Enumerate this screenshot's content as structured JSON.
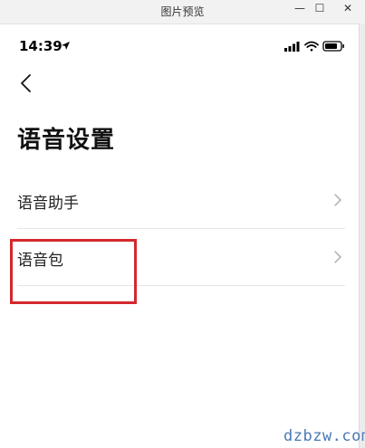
{
  "window": {
    "title": "图片预览",
    "minimize_glyph": "—",
    "maximize_glyph": "☐",
    "close_glyph": "✕"
  },
  "status_bar": {
    "time": "14:39",
    "icons": [
      "location-arrow-icon",
      "signal-icon",
      "wifi-icon",
      "battery-icon"
    ]
  },
  "nav": {
    "back_icon": "chevron-left-icon"
  },
  "page": {
    "title": "语音设置",
    "items": [
      {
        "label": "语音助手",
        "icon": "chevron-right-icon"
      },
      {
        "label": "语音包",
        "icon": "chevron-right-icon",
        "highlighted": true
      }
    ]
  },
  "annotation": {
    "highlight_color": "#d4282d"
  },
  "watermark": {
    "text": "dzbzw.com"
  }
}
